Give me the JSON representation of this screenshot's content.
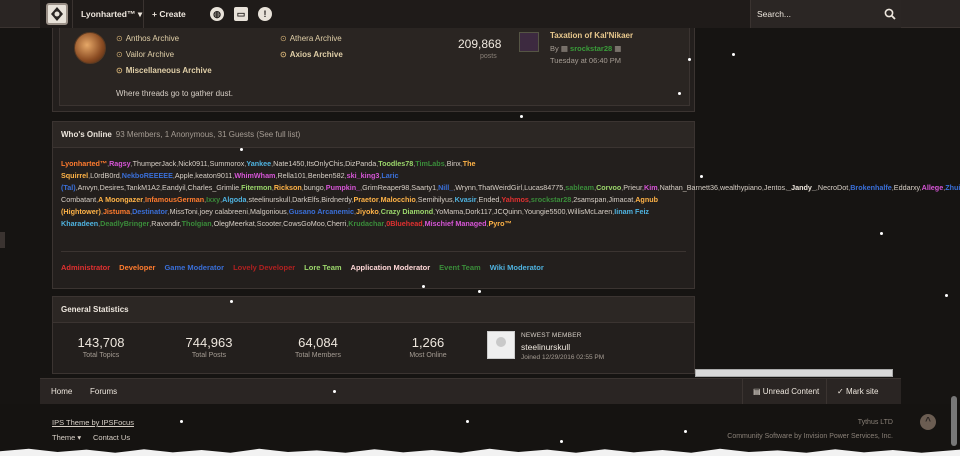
{
  "nav": {
    "user": "Lyonharted™",
    "create": "+ Create",
    "search_placeholder": "Search..."
  },
  "archive": {
    "subforums": [
      "Anthos Archive",
      "Athera Archive",
      "Vailor Archive",
      "Axios Archive",
      "Miscellaneous Archive"
    ],
    "description": "Where threads go to gather dust.",
    "posts": "209,868",
    "posts_label": "posts",
    "last_title": "Taxation of Kal'Nikaer",
    "last_by_prefix": "By",
    "last_by_user": "srockstar28",
    "last_time": "Tuesday at 06:40 PM"
  },
  "online": {
    "title": "Who's Online",
    "summary": "93 Members, 1 Anonymous, 31 Guests (See full list)",
    "members": [
      {
        "n": "Lyonharted™",
        "c": "#ff7b2e"
      },
      {
        "n": "Ragsy",
        "c": "#d655d6"
      },
      {
        "n": "ThumperJack",
        "c": "#d7cfc6"
      },
      {
        "n": "Nick0911",
        "c": "#d7cfc6"
      },
      {
        "n": "Summorox",
        "c": "#d7cfc6"
      },
      {
        "n": "Yankee",
        "c": "#4fb3e0"
      },
      {
        "n": "Nate1450",
        "c": "#d7cfc6"
      },
      {
        "n": "ItsOnlyChis",
        "c": "#d7cfc6"
      },
      {
        "n": "DizPanda",
        "c": "#d7cfc6"
      },
      {
        "n": "Toodles78",
        "c": "#9bd66b"
      },
      {
        "n": "TimLabs",
        "c": "#3a8c3a"
      },
      {
        "n": "Binx",
        "c": "#d7cfc6"
      },
      {
        "n": "The Squirrel",
        "c": "#ffb347"
      },
      {
        "n": "L0rdB0rd",
        "c": "#d7cfc6"
      },
      {
        "n": "NekboREEEEE",
        "c": "#3a6fd8"
      },
      {
        "n": "Apple",
        "c": "#d7cfc6"
      },
      {
        "n": "keaton9011",
        "c": "#d7cfc6"
      },
      {
        "n": "WhimWham",
        "c": "#d655d6"
      },
      {
        "n": "Rella101",
        "c": "#d7cfc6"
      },
      {
        "n": "Benben582",
        "c": "#d7cfc6"
      },
      {
        "n": "ski_king3",
        "c": "#d655d6"
      },
      {
        "n": "Laric (Tal)",
        "c": "#3a6fd8"
      },
      {
        "n": "Anvyn",
        "c": "#d7cfc6"
      },
      {
        "n": "Desires",
        "c": "#d7cfc6"
      },
      {
        "n": "TankM1A2",
        "c": "#d7cfc6"
      },
      {
        "n": "Eandyil",
        "c": "#d7cfc6"
      },
      {
        "n": "Charles_Grimlie",
        "c": "#d7cfc6"
      },
      {
        "n": "Fitermon",
        "c": "#9bd66b"
      },
      {
        "n": "Rickson",
        "c": "#ffb347"
      },
      {
        "n": "bungo",
        "c": "#d7cfc6"
      },
      {
        "n": "Pumpkin_",
        "c": "#d655d6"
      },
      {
        "n": "GrimReaper98",
        "c": "#d7cfc6"
      },
      {
        "n": "Saarty1",
        "c": "#d7cfc6"
      },
      {
        "n": "Nill_",
        "c": "#3a6fd8"
      },
      {
        "n": "Wrynn",
        "c": "#d7cfc6"
      },
      {
        "n": "ThatWeirdGirl",
        "c": "#d7cfc6"
      },
      {
        "n": "Lucas84775",
        "c": "#d7cfc6"
      },
      {
        "n": "sableam",
        "c": "#3a8c3a"
      },
      {
        "n": "Corvoo",
        "c": "#9bd66b"
      },
      {
        "n": "Prieur",
        "c": "#d7cfc6"
      },
      {
        "n": "Kim",
        "c": "#d655d6"
      },
      {
        "n": "Nathan_Barnett36",
        "c": "#d7cfc6"
      },
      {
        "n": "wealthypiano",
        "c": "#d7cfc6"
      },
      {
        "n": "Jentos",
        "c": "#d7cfc6"
      },
      {
        "n": "_Jandy_",
        "c": "#eee7de"
      },
      {
        "n": "NecroDot",
        "c": "#d7cfc6"
      },
      {
        "n": "Brokenhalfe",
        "c": "#3a6fd8"
      },
      {
        "n": "Eddarxy",
        "c": "#d7cfc6"
      },
      {
        "n": "Allege",
        "c": "#d655d6"
      },
      {
        "n": "Zhuilk",
        "c": "#3a6fd8"
      },
      {
        "n": "The Combatant",
        "c": "#d7cfc6"
      },
      {
        "n": "A Moongazer",
        "c": "#ffb347"
      },
      {
        "n": "InfamousGerman",
        "c": "#ff7b2e"
      },
      {
        "n": "Ixxy",
        "c": "#3a8c3a"
      },
      {
        "n": "Algoda",
        "c": "#4fb3e0"
      },
      {
        "n": "steelinurskull",
        "c": "#d7cfc6"
      },
      {
        "n": "DarkElfs",
        "c": "#d7cfc6"
      },
      {
        "n": "Birdnerdy",
        "c": "#d7cfc6"
      },
      {
        "n": "Praetor",
        "c": "#ffb347"
      },
      {
        "n": "Malocchio",
        "c": "#ffb347"
      },
      {
        "n": "Semihilyus",
        "c": "#d7cfc6"
      },
      {
        "n": "Kvasir",
        "c": "#4fb3e0"
      },
      {
        "n": "Ended",
        "c": "#d7cfc6"
      },
      {
        "n": "Yahmos",
        "c": "#e03030"
      },
      {
        "n": "srockstar28",
        "c": "#3a8c3a"
      },
      {
        "n": "2samspan",
        "c": "#d7cfc6"
      },
      {
        "n": "Jimacat",
        "c": "#d7cfc6"
      },
      {
        "n": "Agnub (Hightower)",
        "c": "#ffb347"
      },
      {
        "n": "Jistuma",
        "c": "#ff7b2e"
      },
      {
        "n": "Destinator",
        "c": "#3a6fd8"
      },
      {
        "n": "MissToni",
        "c": "#d7cfc6"
      },
      {
        "n": "joey calabreeni",
        "c": "#d7cfc6"
      },
      {
        "n": "Malgonious",
        "c": "#d7cfc6"
      },
      {
        "n": "Gusano Arcanemic",
        "c": "#3a6fd8"
      },
      {
        "n": "Jiyoko",
        "c": "#ffb347"
      },
      {
        "n": "Crazy Diamond",
        "c": "#9bd66b"
      },
      {
        "n": "YoMama",
        "c": "#d7cfc6"
      },
      {
        "n": "Dork117",
        "c": "#d7cfc6"
      },
      {
        "n": "JCQuinn",
        "c": "#d7cfc6"
      },
      {
        "n": "Youngie5500",
        "c": "#d7cfc6"
      },
      {
        "n": "WillisMcLaren",
        "c": "#d7cfc6"
      },
      {
        "n": "Iinam Feiz Kharadeen",
        "c": "#4fb3e0"
      },
      {
        "n": "DeadlyBringer",
        "c": "#3a8c3a"
      },
      {
        "n": "Ravondir",
        "c": "#d7cfc6"
      },
      {
        "n": "Tholgian",
        "c": "#3a8c3a"
      },
      {
        "n": "OlegMeerkat",
        "c": "#d7cfc6"
      },
      {
        "n": "Scooter",
        "c": "#d7cfc6"
      },
      {
        "n": "CowsGoMoo",
        "c": "#d7cfc6"
      },
      {
        "n": "Cherri",
        "c": "#d7cfc6"
      },
      {
        "n": "Krudachar",
        "c": "#3a8c3a"
      },
      {
        "n": "0Bluehead",
        "c": "#e03030"
      },
      {
        "n": "Mischief Managed",
        "c": "#d655d6"
      },
      {
        "n": "Pyro™",
        "c": "#ffb347"
      }
    ],
    "legend": [
      {
        "n": "Administrator",
        "c": "#e03030"
      },
      {
        "n": "Developer",
        "c": "#ff7b2e"
      },
      {
        "n": "Game Moderator",
        "c": "#3a6fd8"
      },
      {
        "n": "Lovely Developer",
        "c": "#b02020"
      },
      {
        "n": "Lore Team",
        "c": "#9bd66b"
      },
      {
        "n": "Application Moderator",
        "c": "#ffd7d7"
      },
      {
        "n": "Event Team",
        "c": "#3a8c3a"
      },
      {
        "n": "Wiki Moderator",
        "c": "#4fb3e0"
      }
    ]
  },
  "stats": {
    "title": "General Statistics",
    "items": [
      {
        "n": "143,708",
        "l": "Total Topics"
      },
      {
        "n": "744,963",
        "l": "Total Posts"
      },
      {
        "n": "64,084",
        "l": "Total Members"
      },
      {
        "n": "1,266",
        "l": "Most Online"
      }
    ],
    "newest_label": "NEWEST MEMBER",
    "newest_name": "steelinurskull",
    "newest_joined": "Joined 12/29/2016 02:55 PM"
  },
  "footer_nav": {
    "home": "Home",
    "forums": "Forums",
    "unread": "Unread Content",
    "mark_read": "Mark site read"
  },
  "footer": {
    "theme_credit": "IPS Theme by IPSFocus",
    "theme": "Theme",
    "contact": "Contact Us",
    "company": "Tythus LTD",
    "software": "Community Software by Invision Power Services, Inc."
  }
}
